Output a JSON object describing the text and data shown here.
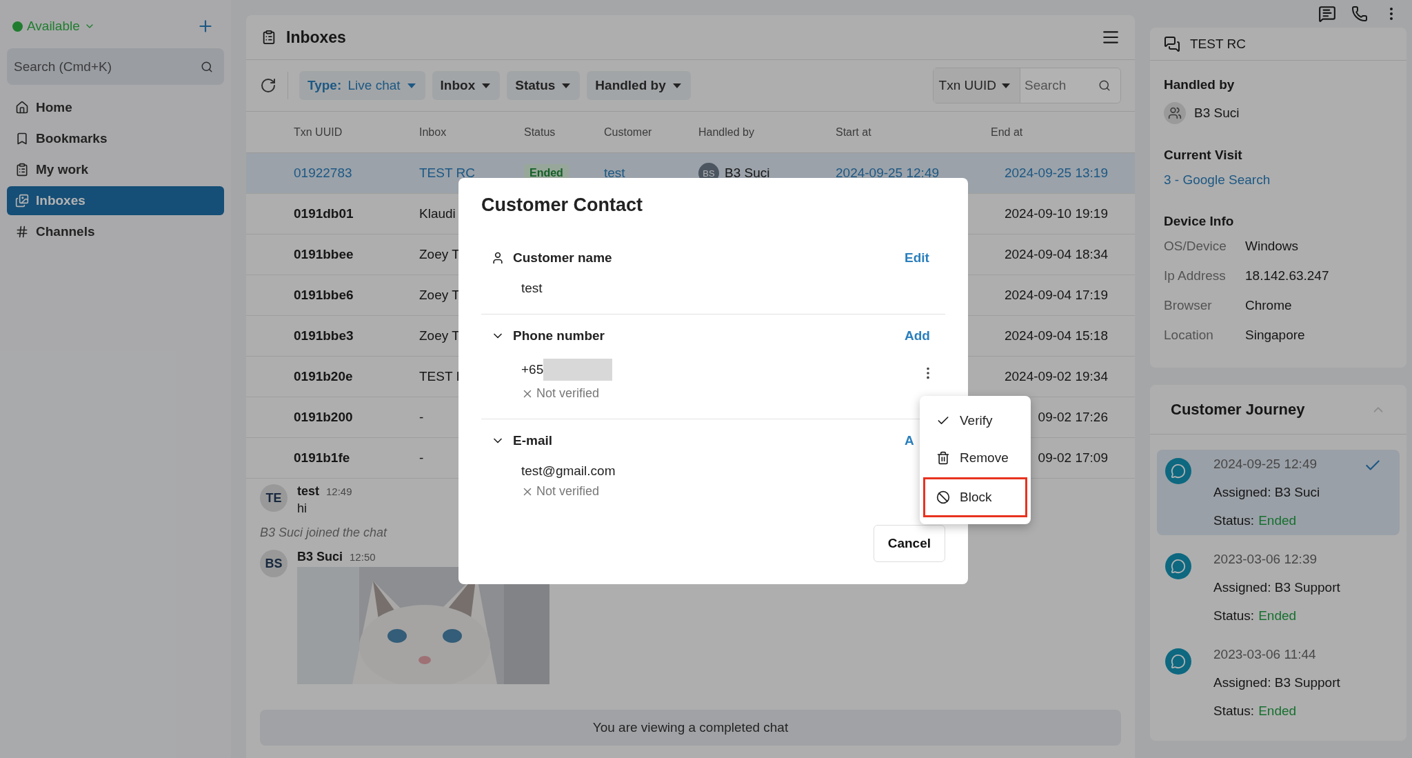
{
  "sidebar": {
    "status": {
      "label": "Available"
    },
    "search": {
      "placeholder": "Search (Cmd+K)"
    },
    "items": [
      {
        "kind": "home",
        "label": "Home",
        "selected": false
      },
      {
        "kind": "bookmark",
        "label": "Bookmarks",
        "selected": false
      },
      {
        "kind": "list",
        "label": "My work",
        "selected": false
      },
      {
        "kind": "inbox",
        "label": "Inboxes",
        "selected": true
      },
      {
        "kind": "hash",
        "label": "Channels",
        "selected": false
      }
    ]
  },
  "inboxes": {
    "title": "Inboxes",
    "filters": [
      {
        "label": "Type:",
        "value": "Live chat",
        "active": true
      },
      {
        "label": "Inbox",
        "active": false
      },
      {
        "label": "Status",
        "active": false
      },
      {
        "label": "Handled by",
        "active": false
      }
    ],
    "search": {
      "field": "Txn UUID",
      "placeholder": "Search"
    },
    "table": {
      "columns": [
        "Txn UUID",
        "Inbox",
        "Status",
        "Customer",
        "Handled by",
        "Start at",
        "End at"
      ],
      "rows": [
        {
          "selected": true,
          "txn": "01922783",
          "inbox": "TEST RC",
          "status": "Ended",
          "customer": "test",
          "handled_initials": "BS",
          "handled_by": "B3 Suci",
          "start": "2024-09-25 12:49",
          "end": "2024-09-25 13:19"
        },
        {
          "selected": false,
          "txn": "0191db01",
          "inbox": "Klaudi",
          "end": "2024-09-10 19:19"
        },
        {
          "selected": false,
          "txn": "0191bbee",
          "inbox": "Zoey T",
          "end": "2024-09-04 18:34"
        },
        {
          "selected": false,
          "txn": "0191bbe6",
          "inbox": "Zoey T",
          "end": "2024-09-04 17:19"
        },
        {
          "selected": false,
          "txn": "0191bbe3",
          "inbox": "Zoey T",
          "end": "2024-09-04 15:18"
        },
        {
          "selected": false,
          "txn": "0191b20e",
          "inbox": "TEST I",
          "end": "2024-09-02 19:34"
        },
        {
          "selected": false,
          "txn": "0191b200",
          "inbox": "-",
          "end": "09-02 17:26"
        },
        {
          "selected": false,
          "txn": "0191b1fe",
          "inbox": "-",
          "end": "09-02 17:09"
        }
      ]
    }
  },
  "chat": {
    "messages": [
      {
        "kind": "message",
        "initials": "TE",
        "author": "test",
        "time": "12:49",
        "text": "hi"
      },
      {
        "kind": "event",
        "text": "B3 Suci joined the chat"
      },
      {
        "kind": "message",
        "initials": "BS",
        "author": "B3 Suci",
        "time": "12:50"
      }
    ],
    "notice": "You are viewing a completed chat"
  },
  "details": {
    "title": "TEST RC",
    "handled": {
      "title": "Handled by",
      "name": "B3 Suci"
    },
    "visit": {
      "title": "Current Visit",
      "link": "3 - Google Search"
    },
    "device": {
      "title": "Device Info",
      "rows": [
        {
          "label": "OS/Device",
          "value": "Windows"
        },
        {
          "label": "Ip Address",
          "value": "18.142.63.247"
        },
        {
          "label": "Browser",
          "value": "Chrome"
        },
        {
          "label": "Location",
          "value": "Singapore"
        }
      ]
    }
  },
  "journey": {
    "title": "Customer Journey",
    "items": [
      {
        "time": "2024-09-25 12:49",
        "assigned": "Assigned: B3 Suci",
        "status_label": "Status:",
        "status": "Ended",
        "selected": true
      },
      {
        "time": "2023-03-06 12:39",
        "assigned": "Assigned: B3 Support",
        "status_label": "Status:",
        "status": "Ended",
        "selected": false
      },
      {
        "time": "2023-03-06 11:44",
        "assigned": "Assigned: B3 Support",
        "status_label": "Status:",
        "status": "Ended",
        "selected": false
      }
    ]
  },
  "dialog": {
    "title": "Customer Contact",
    "sections": [
      {
        "kind": "name",
        "label": "Customer name",
        "action": "Edit",
        "value": "test"
      },
      {
        "kind": "phone",
        "label": "Phone number",
        "action": "Add",
        "expanded": true,
        "entries": [
          {
            "value": "+65",
            "masked": true,
            "verified": false,
            "verify_label": "Not verified"
          }
        ]
      },
      {
        "kind": "email",
        "label": "E-mail",
        "action": "A",
        "expanded": true,
        "entries": [
          {
            "value": "test@gmail.com",
            "verified": false,
            "verify_label": "Not verified"
          }
        ]
      }
    ],
    "cancel": "Cancel"
  },
  "menu": {
    "items": [
      {
        "kind": "verify",
        "label": "Verify",
        "highlighted": false
      },
      {
        "kind": "remove",
        "label": "Remove",
        "highlighted": false
      },
      {
        "kind": "block",
        "label": "Block",
        "highlighted": true
      }
    ]
  }
}
